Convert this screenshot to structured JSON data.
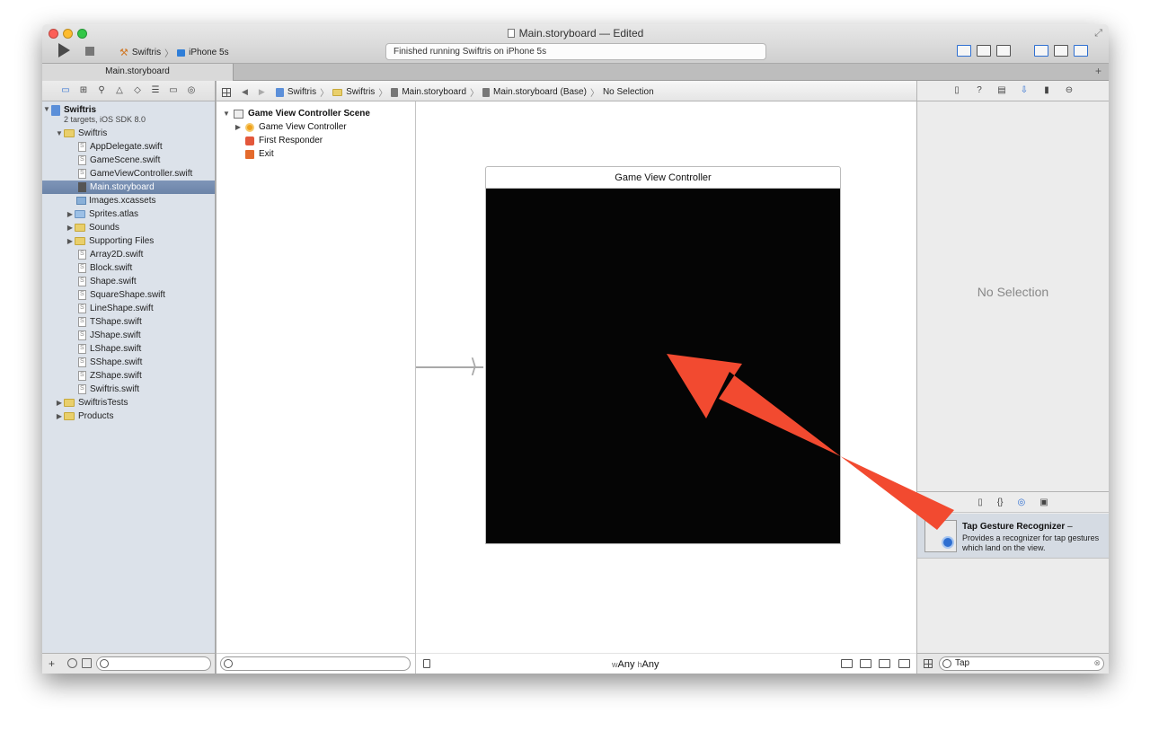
{
  "window": {
    "title": "Main.storyboard — Edited"
  },
  "toolbar": {
    "scheme_project": "Swiftris",
    "scheme_separator": "〉",
    "scheme_device": "iPhone 5s",
    "activity_status": "Finished running Swiftris on iPhone 5s"
  },
  "tabs": [
    {
      "label": "Main.storyboard"
    }
  ],
  "jumpbar": {
    "crumbs": [
      "Swiftris",
      "Swiftris",
      "Main.storyboard",
      "Main.storyboard (Base)",
      "No Selection"
    ]
  },
  "navigator": {
    "project": {
      "name": "Swiftris",
      "subtitle": "2 targets, iOS SDK 8.0"
    },
    "items": [
      {
        "label": "Swiftris"
      },
      {
        "label": "AppDelegate.swift"
      },
      {
        "label": "GameScene.swift"
      },
      {
        "label": "GameViewController.swift"
      },
      {
        "label": "Main.storyboard"
      },
      {
        "label": "Images.xcassets"
      },
      {
        "label": "Sprites.atlas"
      },
      {
        "label": "Sounds"
      },
      {
        "label": "Supporting Files"
      },
      {
        "label": "Array2D.swift"
      },
      {
        "label": "Block.swift"
      },
      {
        "label": "Shape.swift"
      },
      {
        "label": "SquareShape.swift"
      },
      {
        "label": "LineShape.swift"
      },
      {
        "label": "TShape.swift"
      },
      {
        "label": "JShape.swift"
      },
      {
        "label": "LShape.swift"
      },
      {
        "label": "SShape.swift"
      },
      {
        "label": "ZShape.swift"
      },
      {
        "label": "Swiftris.swift"
      },
      {
        "label": "SwiftrisTests"
      },
      {
        "label": "Products"
      }
    ]
  },
  "outline": {
    "scene": "Game View Controller Scene",
    "items": [
      "Game View Controller",
      "First Responder",
      "Exit"
    ]
  },
  "canvas": {
    "vc_title": "Game View Controller",
    "size_w_prefix": "w",
    "size_w": "Any",
    "size_h_prefix": "h",
    "size_h": "Any"
  },
  "inspector": {
    "no_selection": "No Selection",
    "library_item": {
      "name": "Tap Gesture Recognizer",
      "suffix": " –",
      "description": "Provides a recognizer for tap gestures which land on the view."
    },
    "filter_value": "Tap"
  },
  "annotation": {
    "arrow_color": "#f24a30"
  }
}
